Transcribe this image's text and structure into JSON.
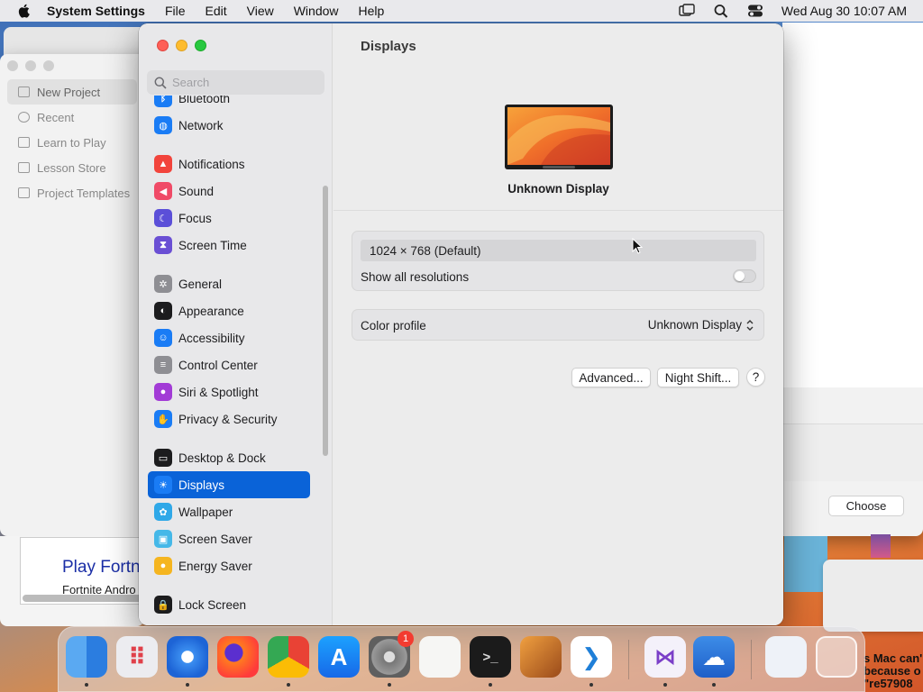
{
  "menubar": {
    "app": "System Settings",
    "menus": [
      "File",
      "Edit",
      "View",
      "Window",
      "Help"
    ],
    "clock": "Wed Aug 30  10:07 AM"
  },
  "background": {
    "sidebar": [
      "New Project",
      "Recent",
      "Learn to Play",
      "Lesson Store",
      "Project Templates"
    ],
    "choose_button": "Choose",
    "browser_title": "Play Fortn",
    "browser_sub": "Fortnite Andro",
    "corner_text": [
      "s Mac can'",
      "because o",
      "\"re57908"
    ]
  },
  "settings": {
    "search_placeholder": "Search",
    "nav": [
      {
        "label": "Bluetooth",
        "icon": "bluetooth-icon",
        "color": "#1a7cf5"
      },
      {
        "label": "Network",
        "icon": "globe-icon",
        "color": "#1a7cf5"
      },
      {
        "label": "Notifications",
        "icon": "bell-icon",
        "color": "#f2443c"
      },
      {
        "label": "Sound",
        "icon": "speaker-icon",
        "color": "#f04a67"
      },
      {
        "label": "Focus",
        "icon": "moon-icon",
        "color": "#5b4fd8"
      },
      {
        "label": "Screen Time",
        "icon": "hourglass-icon",
        "color": "#6a4fd4"
      },
      {
        "label": "General",
        "icon": "gear-icon",
        "color": "#8e8e93"
      },
      {
        "label": "Appearance",
        "icon": "appearance-icon",
        "color": "#1c1c1e"
      },
      {
        "label": "Accessibility",
        "icon": "accessibility-icon",
        "color": "#1a7cf5"
      },
      {
        "label": "Control Center",
        "icon": "switches-icon",
        "color": "#8e8e93"
      },
      {
        "label": "Siri & Spotlight",
        "icon": "siri-icon",
        "color": "#a23bd6"
      },
      {
        "label": "Privacy & Security",
        "icon": "hand-icon",
        "color": "#1a7cf5"
      },
      {
        "label": "Desktop & Dock",
        "icon": "dock-icon",
        "color": "#1c1c1e"
      },
      {
        "label": "Displays",
        "icon": "sun-icon",
        "color": "#1a7cf5"
      },
      {
        "label": "Wallpaper",
        "icon": "flower-icon",
        "color": "#2fa8e8"
      },
      {
        "label": "Screen Saver",
        "icon": "screensaver-icon",
        "color": "#45b8e8"
      },
      {
        "label": "Energy Saver",
        "icon": "bulb-icon",
        "color": "#f5b520"
      },
      {
        "label": "Lock Screen",
        "icon": "lock-icon",
        "color": "#1c1c1e"
      }
    ],
    "selected": "Displays",
    "title": "Displays",
    "display_name": "Unknown Display",
    "resolution": "1024 × 768 (Default)",
    "show_all_label": "Show all resolutions",
    "show_all_on": false,
    "color_profile_label": "Color profile",
    "color_profile_value": "Unknown Display",
    "advanced_button": "Advanced...",
    "night_shift_button": "Night Shift...",
    "help_button": "?"
  },
  "dock": {
    "apps": [
      "Finder",
      "Launchpad",
      "Safari",
      "Firefox",
      "Chrome",
      "App Store",
      "System Settings",
      "TextEdit",
      "Terminal",
      "GarageBand",
      "Visual Studio Code",
      "Visual Studio",
      "OneDrive",
      "Downloads",
      "Trash"
    ],
    "settings_badge": "1"
  }
}
